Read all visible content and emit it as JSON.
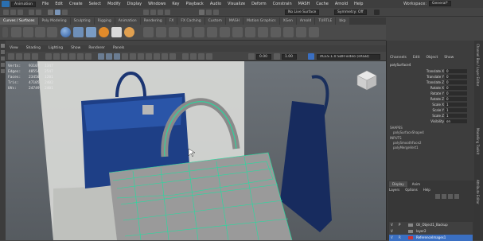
{
  "menubar": {
    "items": [
      "File",
      "Edit",
      "Create",
      "Select",
      "Modify",
      "Display",
      "Windows",
      "Key",
      "Playback",
      "Audio",
      "Visualize",
      "Deform",
      "Constrain",
      "MASH",
      "Cache",
      "Arnold",
      "Help"
    ],
    "mode": "Animation",
    "workspace_label": "Workspace:",
    "workspace_value": "General*",
    "live_surface": "No Live Surface",
    "symmetry": "Symmetry: Off"
  },
  "shelf": {
    "tabs": [
      "Curves / Surfaces",
      "Poly Modeling",
      "Sculpting",
      "Rigging",
      "Animation",
      "Rendering",
      "FX",
      "FX Caching",
      "Custom",
      "MASH",
      "Motion Graphics",
      "XGen",
      "Arnold",
      "TURTLE",
      "bkp"
    ],
    "active_tab": 0
  },
  "panel": {
    "menus": [
      "View",
      "Shading",
      "Lighting",
      "Show",
      "Renderer",
      "Panels"
    ],
    "value_a": "0.00",
    "value_b": "1.00",
    "color_space": "ACES 1.0 SDR-video (sRGB)"
  },
  "hud": {
    "rows": [
      {
        "k": "Verts:",
        "v": "93107",
        "v2": "1347"
      },
      {
        "k": "Edges:",
        "v": "48554",
        "v2": "2547"
      },
      {
        "k": "Faces:",
        "v": "23450",
        "v2": "1201"
      },
      {
        "k": "Tris:",
        "v": "47105",
        "v2": "2402"
      },
      {
        "k": "UVs:",
        "v": "24749",
        "v2": "2401"
      }
    ]
  },
  "channel_box": {
    "tabs": [
      "Channels",
      "Edit",
      "Object",
      "Show"
    ],
    "object_name": "polySurface4",
    "attributes": [
      {
        "label": "Translate X",
        "value": "0"
      },
      {
        "label": "Translate Y",
        "value": "0"
      },
      {
        "label": "Translate Z",
        "value": "0"
      },
      {
        "label": "Rotate X",
        "value": "0"
      },
      {
        "label": "Rotate Y",
        "value": "0"
      },
      {
        "label": "Rotate Z",
        "value": "0"
      },
      {
        "label": "Scale X",
        "value": "1"
      },
      {
        "label": "Scale Y",
        "value": "1"
      },
      {
        "label": "Scale Z",
        "value": "1"
      },
      {
        "label": "Visibility",
        "value": "on"
      }
    ],
    "shapes_label": "SHAPES",
    "shape_name": "polySurfaceShape4",
    "inputs_label": "INPUTS",
    "inputs": [
      "polySmoothFace2",
      "polyMergeVert1"
    ]
  },
  "layers": {
    "tabs": [
      "Display",
      "Anim"
    ],
    "menus": [
      "Layers",
      "Options",
      "Help"
    ],
    "rows": [
      {
        "v": "V",
        "p": "P",
        "name": "Oil_Object1_Backup"
      },
      {
        "v": "V",
        "p": "",
        "name": "layer2"
      },
      {
        "v": "V",
        "p": "R",
        "name": "ReferenceImages1"
      }
    ]
  },
  "side_tabs": [
    "Channel Box / Layer Editor",
    "Modelling Toolkit",
    "Attribute Editor"
  ],
  "colors": {
    "accent": "#1fe0a0",
    "bag": "#1e3f86",
    "selected": "#3a6fc2"
  }
}
